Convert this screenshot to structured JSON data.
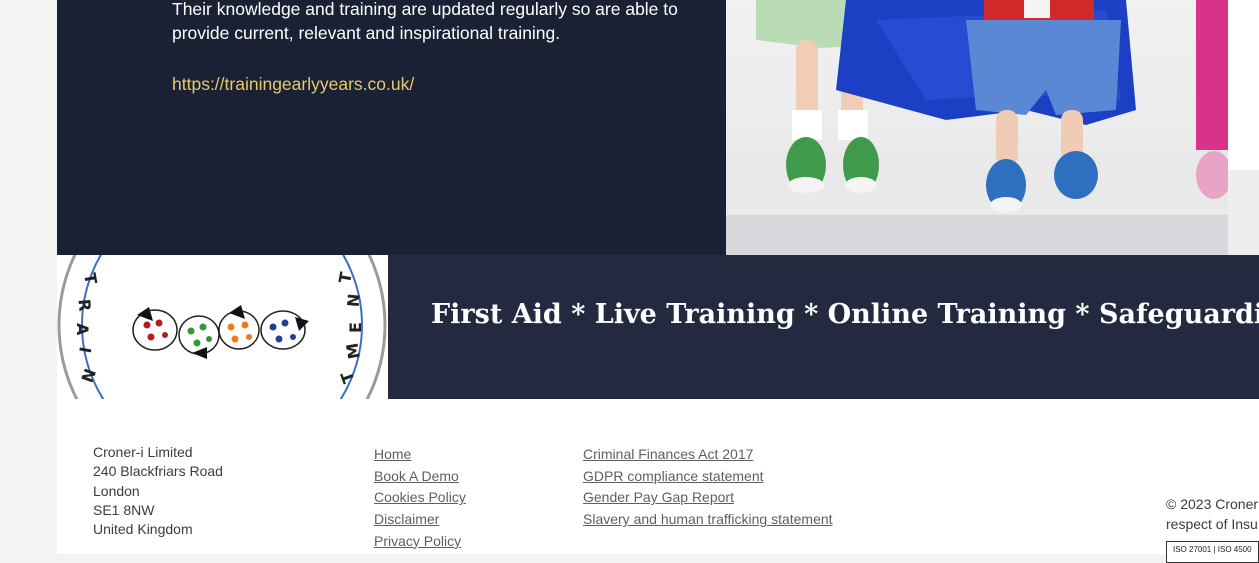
{
  "promo": {
    "body_line1": "Their knowledge and training are updated regularly so are able to",
    "body_line2": "provide current, relevant and inspirational training.",
    "link": "https://trainingearlyyears.co.uk/"
  },
  "logo": {
    "ring_left": "TRAIN",
    "ring_right": "TMEN"
  },
  "banner": {
    "text": "First Aid * Live Training * Online Training * Safeguarding * Com"
  },
  "footer": {
    "address": [
      "Croner-i Limited",
      "240 Blackfriars Road",
      "London",
      "SE1 8NW",
      "United Kingdom"
    ],
    "links_col1": [
      "Home",
      "Book A Demo",
      "Cookies Policy",
      "Disclaimer",
      "Privacy Policy"
    ],
    "links_col2": [
      "Criminal Finances Act 2017",
      "GDPR compliance statement",
      "Gender Pay Gap Report",
      "Slavery and human trafficking statement"
    ],
    "copyright_line1": "© 2023 Croner",
    "copyright_line2": "respect of Insu",
    "iso_badge": "ISO 27001 | ISO 4500"
  },
  "colors": {
    "dark_panel": "#1b2134",
    "banner": "#232a40",
    "link_gold": "#e7c86c"
  }
}
